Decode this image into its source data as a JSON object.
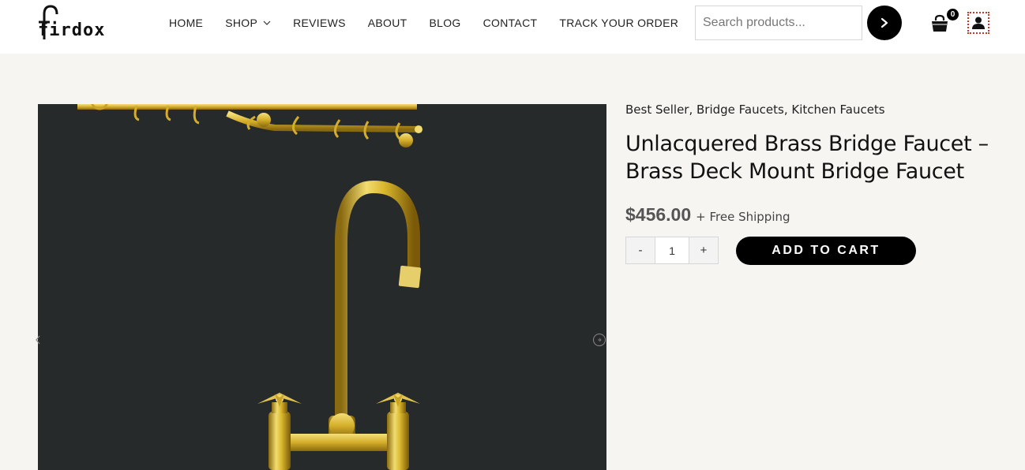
{
  "header": {
    "logo_text": "firdox",
    "nav": [
      {
        "label": "HOME"
      },
      {
        "label": "SHOP",
        "has_dropdown": true
      },
      {
        "label": "REVIEWS"
      },
      {
        "label": "ABOUT"
      },
      {
        "label": "BLOG"
      },
      {
        "label": "CONTACT"
      },
      {
        "label": "TRACK YOUR ORDER"
      }
    ],
    "search": {
      "placeholder": "Search products...",
      "value": ""
    },
    "cart": {
      "count": "0",
      "icon": "shopping-bag-icon"
    },
    "account": {
      "icon": "user-icon"
    }
  },
  "product": {
    "categories": [
      "Best Seller",
      "Bridge Faucets",
      "Kitchen Faucets"
    ],
    "title": "Unlacquered Brass Bridge Faucet – Brass Deck Mount Bridge Faucet",
    "price": "$456.00",
    "shipping_note": "+ Free Shipping",
    "quantity": {
      "minus": "-",
      "value": "1",
      "plus": "+"
    },
    "add_to_cart": "ADD TO CART"
  },
  "gallery": {
    "prev_icon": "chevron-left-icon",
    "next_icon": "chevron-right-circle-icon"
  },
  "colors": {
    "page_bg": "#f6f5f2",
    "header_bg": "#ffffff",
    "accent": "#000000",
    "price": "#555555",
    "image_bg": "#272a2b",
    "brass": "#d9b62c"
  }
}
